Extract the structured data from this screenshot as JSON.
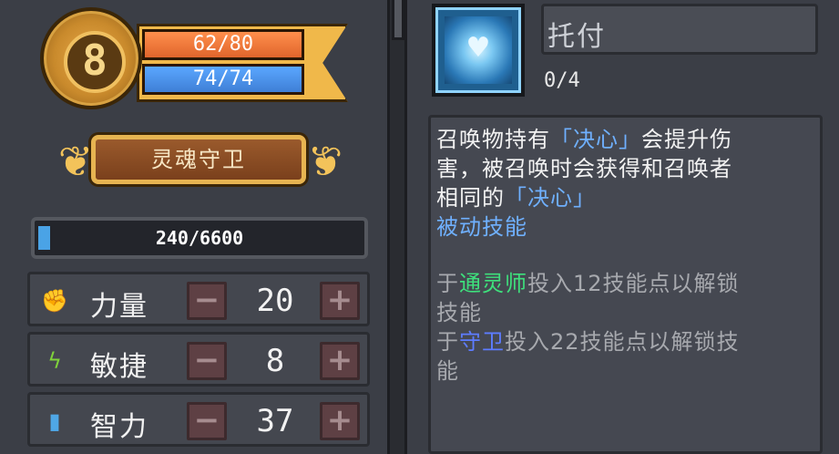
{
  "character": {
    "level": "8",
    "hp": "62/80",
    "mp": "74/74",
    "class_name": "灵魂守卫",
    "xp": "240/6600",
    "xp_fraction": 0.036
  },
  "stats": [
    {
      "label": "力量",
      "value": "20",
      "icon": "fist-icon",
      "color": "#e0483a"
    },
    {
      "label": "敏捷",
      "value": "8",
      "icon": "lightning-icon",
      "color": "#7fd13b"
    },
    {
      "label": "智力",
      "value": "37",
      "icon": "book-icon",
      "color": "#4fa7e6"
    }
  ],
  "skill": {
    "name": "托付",
    "level": "0/4",
    "icon": "heart-hands-icon",
    "desc": {
      "line1_a": "召唤物持有",
      "line1_b": "「决心」",
      "line1_c": "会提升伤",
      "line2": "害，被召唤时会获得和召唤者",
      "line3_a": "相同的",
      "line3_b": "「决心」",
      "passive": "被动技能",
      "req1_a": "于",
      "req1_b": "通灵师",
      "req1_c": "投入12技能点以解锁",
      "req1_d": "技能",
      "req2_a": "于",
      "req2_b": "守卫",
      "req2_c": "投入22技能点以解锁技",
      "req2_d": "能"
    }
  },
  "colors": {
    "hp": "#e0652c",
    "mp": "#3f7fd6",
    "gold": "#e7b451",
    "xp_fill": "#4aa3e6",
    "highlight_blue": "#6fb0ff",
    "highlight_green": "#3ee07c",
    "highlight_indigo": "#5d7cff"
  }
}
